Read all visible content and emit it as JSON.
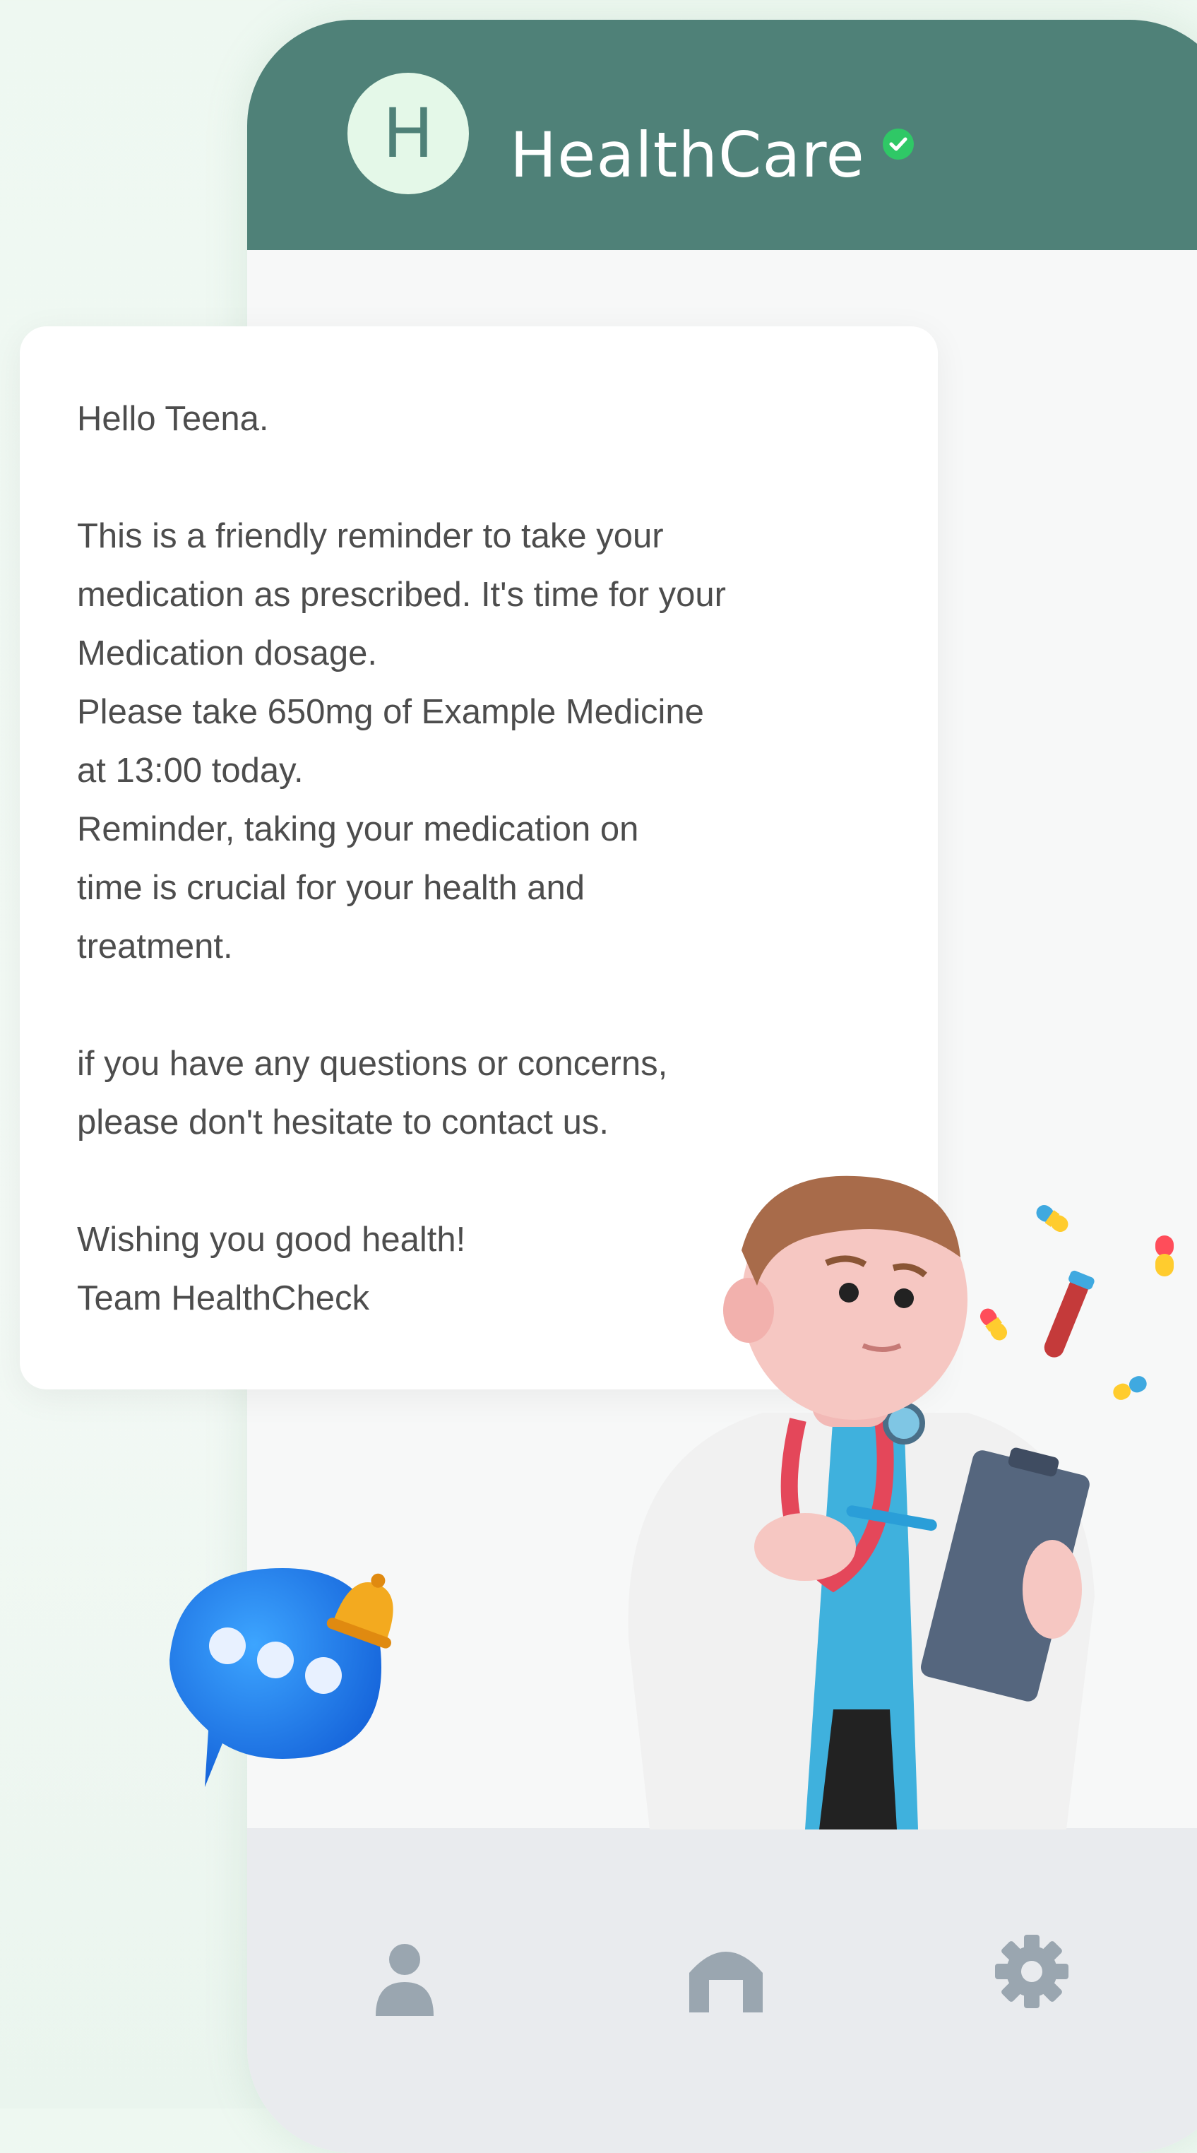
{
  "app": {
    "avatar_letter": "H",
    "title": "HealthCare",
    "verified_icon": "verified-check-icon",
    "header_color": "#4f8178"
  },
  "message": {
    "greeting": "Hello Teena.",
    "line1": "This is a friendly reminder to take your",
    "line2": "medication as prescribed. It's time for your",
    "line3": "Medication dosage.",
    "line4": "Please take 650mg of Example Medicine",
    "line5": "at 13:00 today.",
    "line6": "Reminder, taking your medication on",
    "line7": "time is crucial for your health and",
    "line8": "treatment.",
    "line9": "if you have any questions or concerns,",
    "line10": "please don't hesitate to contact us.",
    "line11": "Wishing you good health!",
    "signature": "Team HealthCheck"
  },
  "bottom_nav": {
    "items": [
      {
        "icon": "profile-icon"
      },
      {
        "icon": "home-icon"
      },
      {
        "icon": "settings-icon"
      }
    ],
    "icon_color": "#9aa6b0"
  },
  "illustrations": [
    "doctor-illustration",
    "chat-bubble-bell-icon",
    "pill-icon",
    "test-tube-icon"
  ]
}
